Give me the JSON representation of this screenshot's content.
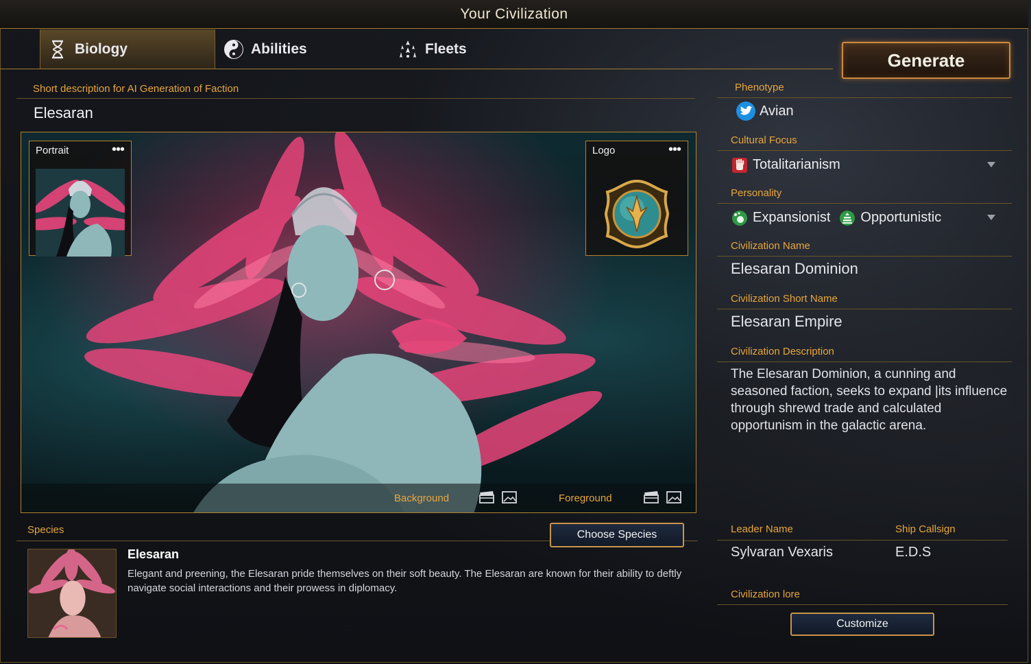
{
  "window": {
    "title": "Your Civilization"
  },
  "tabs": [
    {
      "label": "Biology",
      "icon": "dna-hourglass-icon",
      "active": true
    },
    {
      "label": "Abilities",
      "icon": "yin-yang-icon",
      "active": false
    },
    {
      "label": "Fleets",
      "icon": "fleet-ships-icon",
      "active": false
    }
  ],
  "generate_button": {
    "label": "Generate"
  },
  "faction": {
    "short_description_label": "Short description for AI Generation of Faction",
    "short_description_value": "Elesaran"
  },
  "hero": {
    "portrait_label": "Portrait",
    "logo_label": "Logo",
    "more_glyph": "•••",
    "background_label": "Background",
    "foreground_label": "Foreground"
  },
  "species": {
    "label": "Species",
    "choose_button": "Choose Species",
    "name": "Elesaran",
    "description": "Elegant and preening, the Elesaran pride themselves on their soft beauty. The Elesaran are known for their ability to deftly navigate social interactions and their prowess in diplomacy."
  },
  "right_panel": {
    "phenotype_label": "Phenotype",
    "phenotype_value": "Avian",
    "cultural_focus_label": "Cultural Focus",
    "cultural_focus_value": "Totalitarianism",
    "personality_label": "Personality",
    "personality_values": [
      "Expansionist",
      "Opportunistic"
    ],
    "civ_name_label": "Civilization Name",
    "civ_name_value": "Elesaran Dominion",
    "civ_short_name_label": "Civilization Short Name",
    "civ_short_name_value": "Elesaran Empire",
    "civ_description_label": "Civilization Description",
    "civ_description_value": "The Elesaran Dominion, a cunning and seasoned faction, seeks to expand |its influence through shrewd trade and calculated opportunism in the galactic arena.",
    "leader_name_label": "Leader Name",
    "leader_name_value": "Sylvaran Vexaris",
    "ship_callsign_label": "Ship Callsign",
    "ship_callsign_value": "E.D.S",
    "lore_label": "Civilization lore",
    "customize_button": "Customize"
  },
  "colors": {
    "accent_gold": "#e8a63c",
    "border_gold": "#b4832f",
    "feather_pink": "#e8457a",
    "button_blue": "#1e2a3e"
  }
}
